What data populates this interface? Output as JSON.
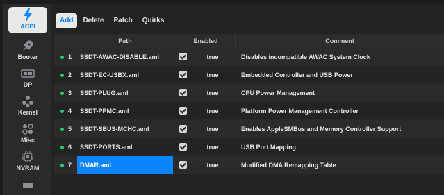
{
  "sidebar": {
    "items": [
      {
        "label": "ACPI",
        "icon": "lightning-icon",
        "active": true
      },
      {
        "label": "Booter",
        "icon": "rocket-icon",
        "active": false
      },
      {
        "label": "DP",
        "icon": "device-properties-icon",
        "active": false
      },
      {
        "label": "Kernel",
        "icon": "kernel-icon",
        "active": false
      },
      {
        "label": "Misc",
        "icon": "misc-icon",
        "active": false
      },
      {
        "label": "NVRAM",
        "icon": "chip-icon",
        "active": false
      }
    ]
  },
  "toolbar": {
    "tabs": [
      {
        "label": "Add",
        "active": true
      },
      {
        "label": "Delete",
        "active": false
      },
      {
        "label": "Patch",
        "active": false
      },
      {
        "label": "Quirks",
        "active": false
      }
    ]
  },
  "table": {
    "headers": {
      "path": "Path",
      "enabled": "Enabled",
      "comment": "Comment"
    },
    "rows": [
      {
        "index": "1",
        "path": "SSDT-AWAC-DISABLE.aml",
        "enabled": "true",
        "comment": "Disables incompatible AWAC System Clock"
      },
      {
        "index": "2",
        "path": "SSDT-EC-USBX.aml",
        "enabled": "true",
        "comment": "Embedded Controller and USB Power"
      },
      {
        "index": "3",
        "path": "SSDT-PLUG.aml",
        "enabled": "true",
        "comment": "CPU Power Management"
      },
      {
        "index": "4",
        "path": "SSDT-PPMC.aml",
        "enabled": "true",
        "comment": "Platform Power Management Controller"
      },
      {
        "index": "5",
        "path": "SSDT-SBUS-MCHC.aml",
        "enabled": "true",
        "comment": "Enables AppleSMBus and Memory Controller Support"
      },
      {
        "index": "6",
        "path": "SSDT-PORTS.aml",
        "enabled": "true",
        "comment": "USB Port Mapping"
      },
      {
        "index": "7",
        "path": "DMAR.aml",
        "enabled": "true",
        "comment": "Modified DMA Remapping Table"
      }
    ],
    "selected_row": 7
  },
  "colors": {
    "accent": "#0a84ff",
    "status_dot": "#2ecc71",
    "background": "#232325"
  }
}
